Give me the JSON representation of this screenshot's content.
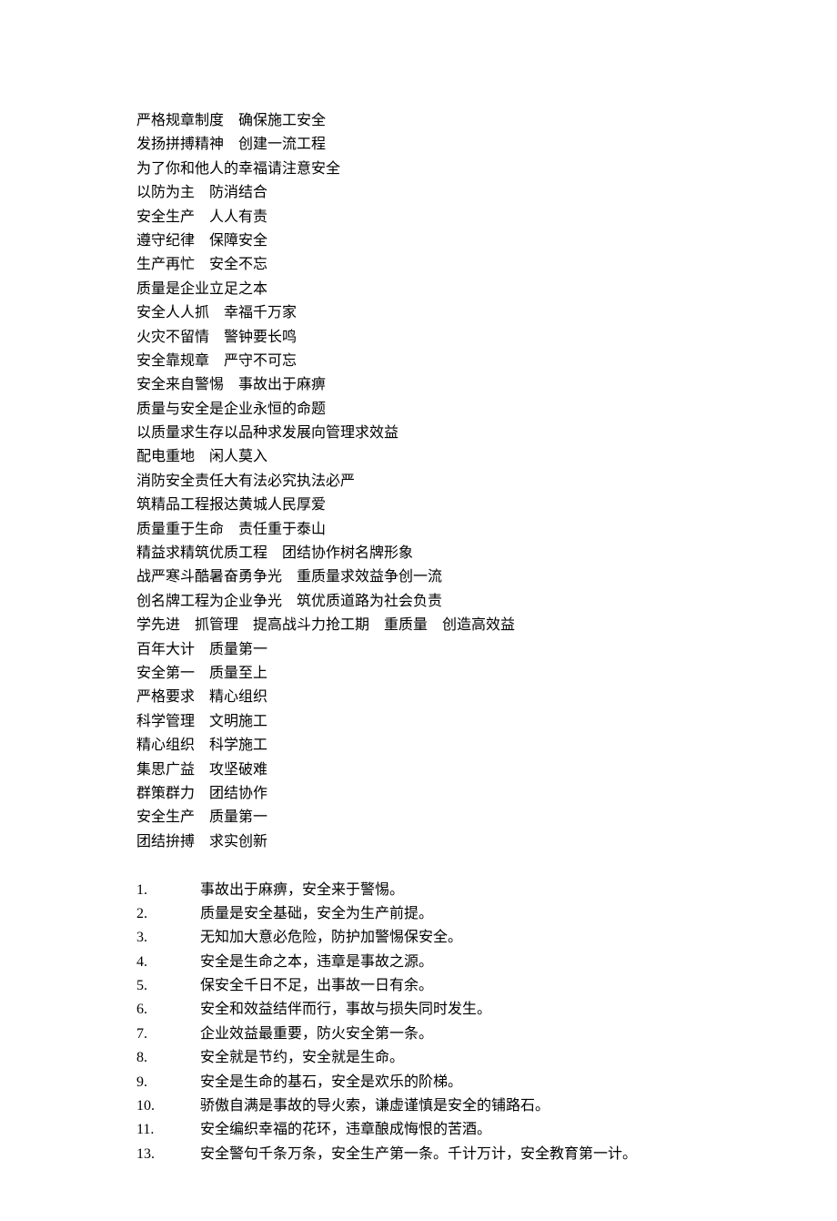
{
  "slogans": [
    "严格规章制度　确保施工安全",
    "发扬拼搏精神　创建一流工程",
    "为了你和他人的幸福请注意安全",
    "以防为主　防消结合",
    "安全生产　人人有责",
    "遵守纪律　保障安全",
    "生产再忙　安全不忘",
    "质量是企业立足之本",
    "安全人人抓　幸福千万家",
    "火灾不留情　警钟要长鸣",
    "安全靠规章　严守不可忘",
    "安全来自警惕　事故出于麻痹",
    "质量与安全是企业永恒的命题",
    "以质量求生存以品种求发展向管理求效益",
    "配电重地　闲人莫入",
    "消防安全责任大有法必究执法必严",
    "筑精品工程报达黄城人民厚爱",
    "质量重于生命　责任重于泰山",
    "精益求精筑优质工程　团结协作树名牌形象",
    "战严寒斗酷暑奋勇争光　重质量求效益争创一流",
    "创名牌工程为企业争光　筑优质道路为社会负责",
    "学先进　抓管理　提高战斗力抢工期　重质量　创造高效益",
    "百年大计　质量第一",
    "安全第一　质量至上",
    "严格要求　精心组织",
    "科学管理　文明施工",
    "精心组织　科学施工",
    "集思广益　攻坚破难",
    "群策群力　团结协作",
    "安全生产　质量第一",
    "团结拚搏　求实创新"
  ],
  "numbered_list": [
    {
      "num": "1.",
      "text": "事故出于麻痹，安全来于警惕。"
    },
    {
      "num": "2.",
      "text": "质量是安全基础，安全为生产前提。"
    },
    {
      "num": "3.",
      "text": "无知加大意必危险，防护加警惕保安全。"
    },
    {
      "num": "4.",
      "text": "安全是生命之本，违章是事故之源。"
    },
    {
      "num": "5.",
      "text": "保安全千日不足，出事故一日有余。"
    },
    {
      "num": "6.",
      "text": "安全和效益结伴而行，事故与损失同时发生。"
    },
    {
      "num": "7.",
      "text": "企业效益最重要，防火安全第一条。"
    },
    {
      "num": "8.",
      "text": "安全就是节约，安全就是生命。"
    },
    {
      "num": "9.",
      "text": "安全是生命的基石，安全是欢乐的阶梯。"
    },
    {
      "num": "10.",
      "text": "骄傲自满是事故的导火索，谦虚谨慎是安全的铺路石。"
    },
    {
      "num": "11.",
      "text": "安全编织幸福的花环，违章酿成悔恨的苦酒。"
    },
    {
      "num": "13.",
      "text": "安全警句千条万条，安全生产第一条。千计万计，安全教育第一计。"
    }
  ]
}
